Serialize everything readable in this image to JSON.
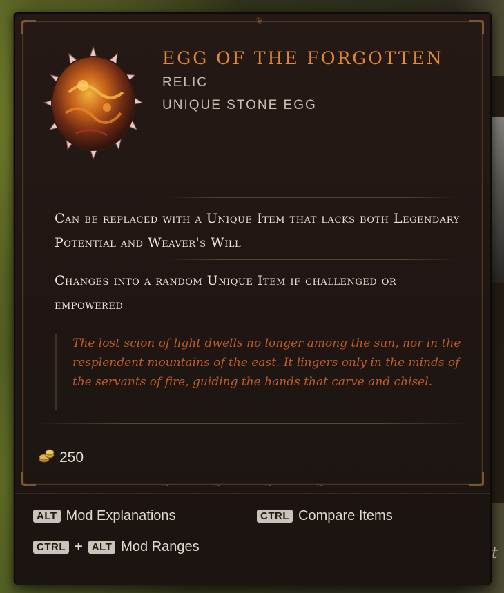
{
  "item": {
    "name": "EGG OF THE FORGOTTEN",
    "type": "RELIC",
    "subtype": "UNIQUE STONE EGG",
    "icon": "spiked-stone-egg-icon"
  },
  "affixes": [
    "Can be replaced with a Unique Item that lacks both Legendary Potential and Weaver's Will",
    "Changes into a random Unique Item if challenged or empowered"
  ],
  "lore": "The lost scion of light dwells no longer among the sun, nor in the resplendent mountains of the east. It lingers only in the minds of the servants of fire, guiding the hands that carve and chisel.",
  "value": {
    "icon": "gold-coins-icon",
    "amount": "250"
  },
  "hints": {
    "mod_explanations": {
      "key": "ALT",
      "label": "Mod Explanations"
    },
    "compare_items": {
      "key": "CTRL",
      "label": "Compare Items"
    },
    "mod_ranges": {
      "key1": "CTRL",
      "plus": "+",
      "key2": "ALT",
      "label": "Mod Ranges"
    }
  },
  "colors": {
    "item_name": "#e38a31",
    "lore": "#c25a24",
    "panel": "#1f1613"
  }
}
